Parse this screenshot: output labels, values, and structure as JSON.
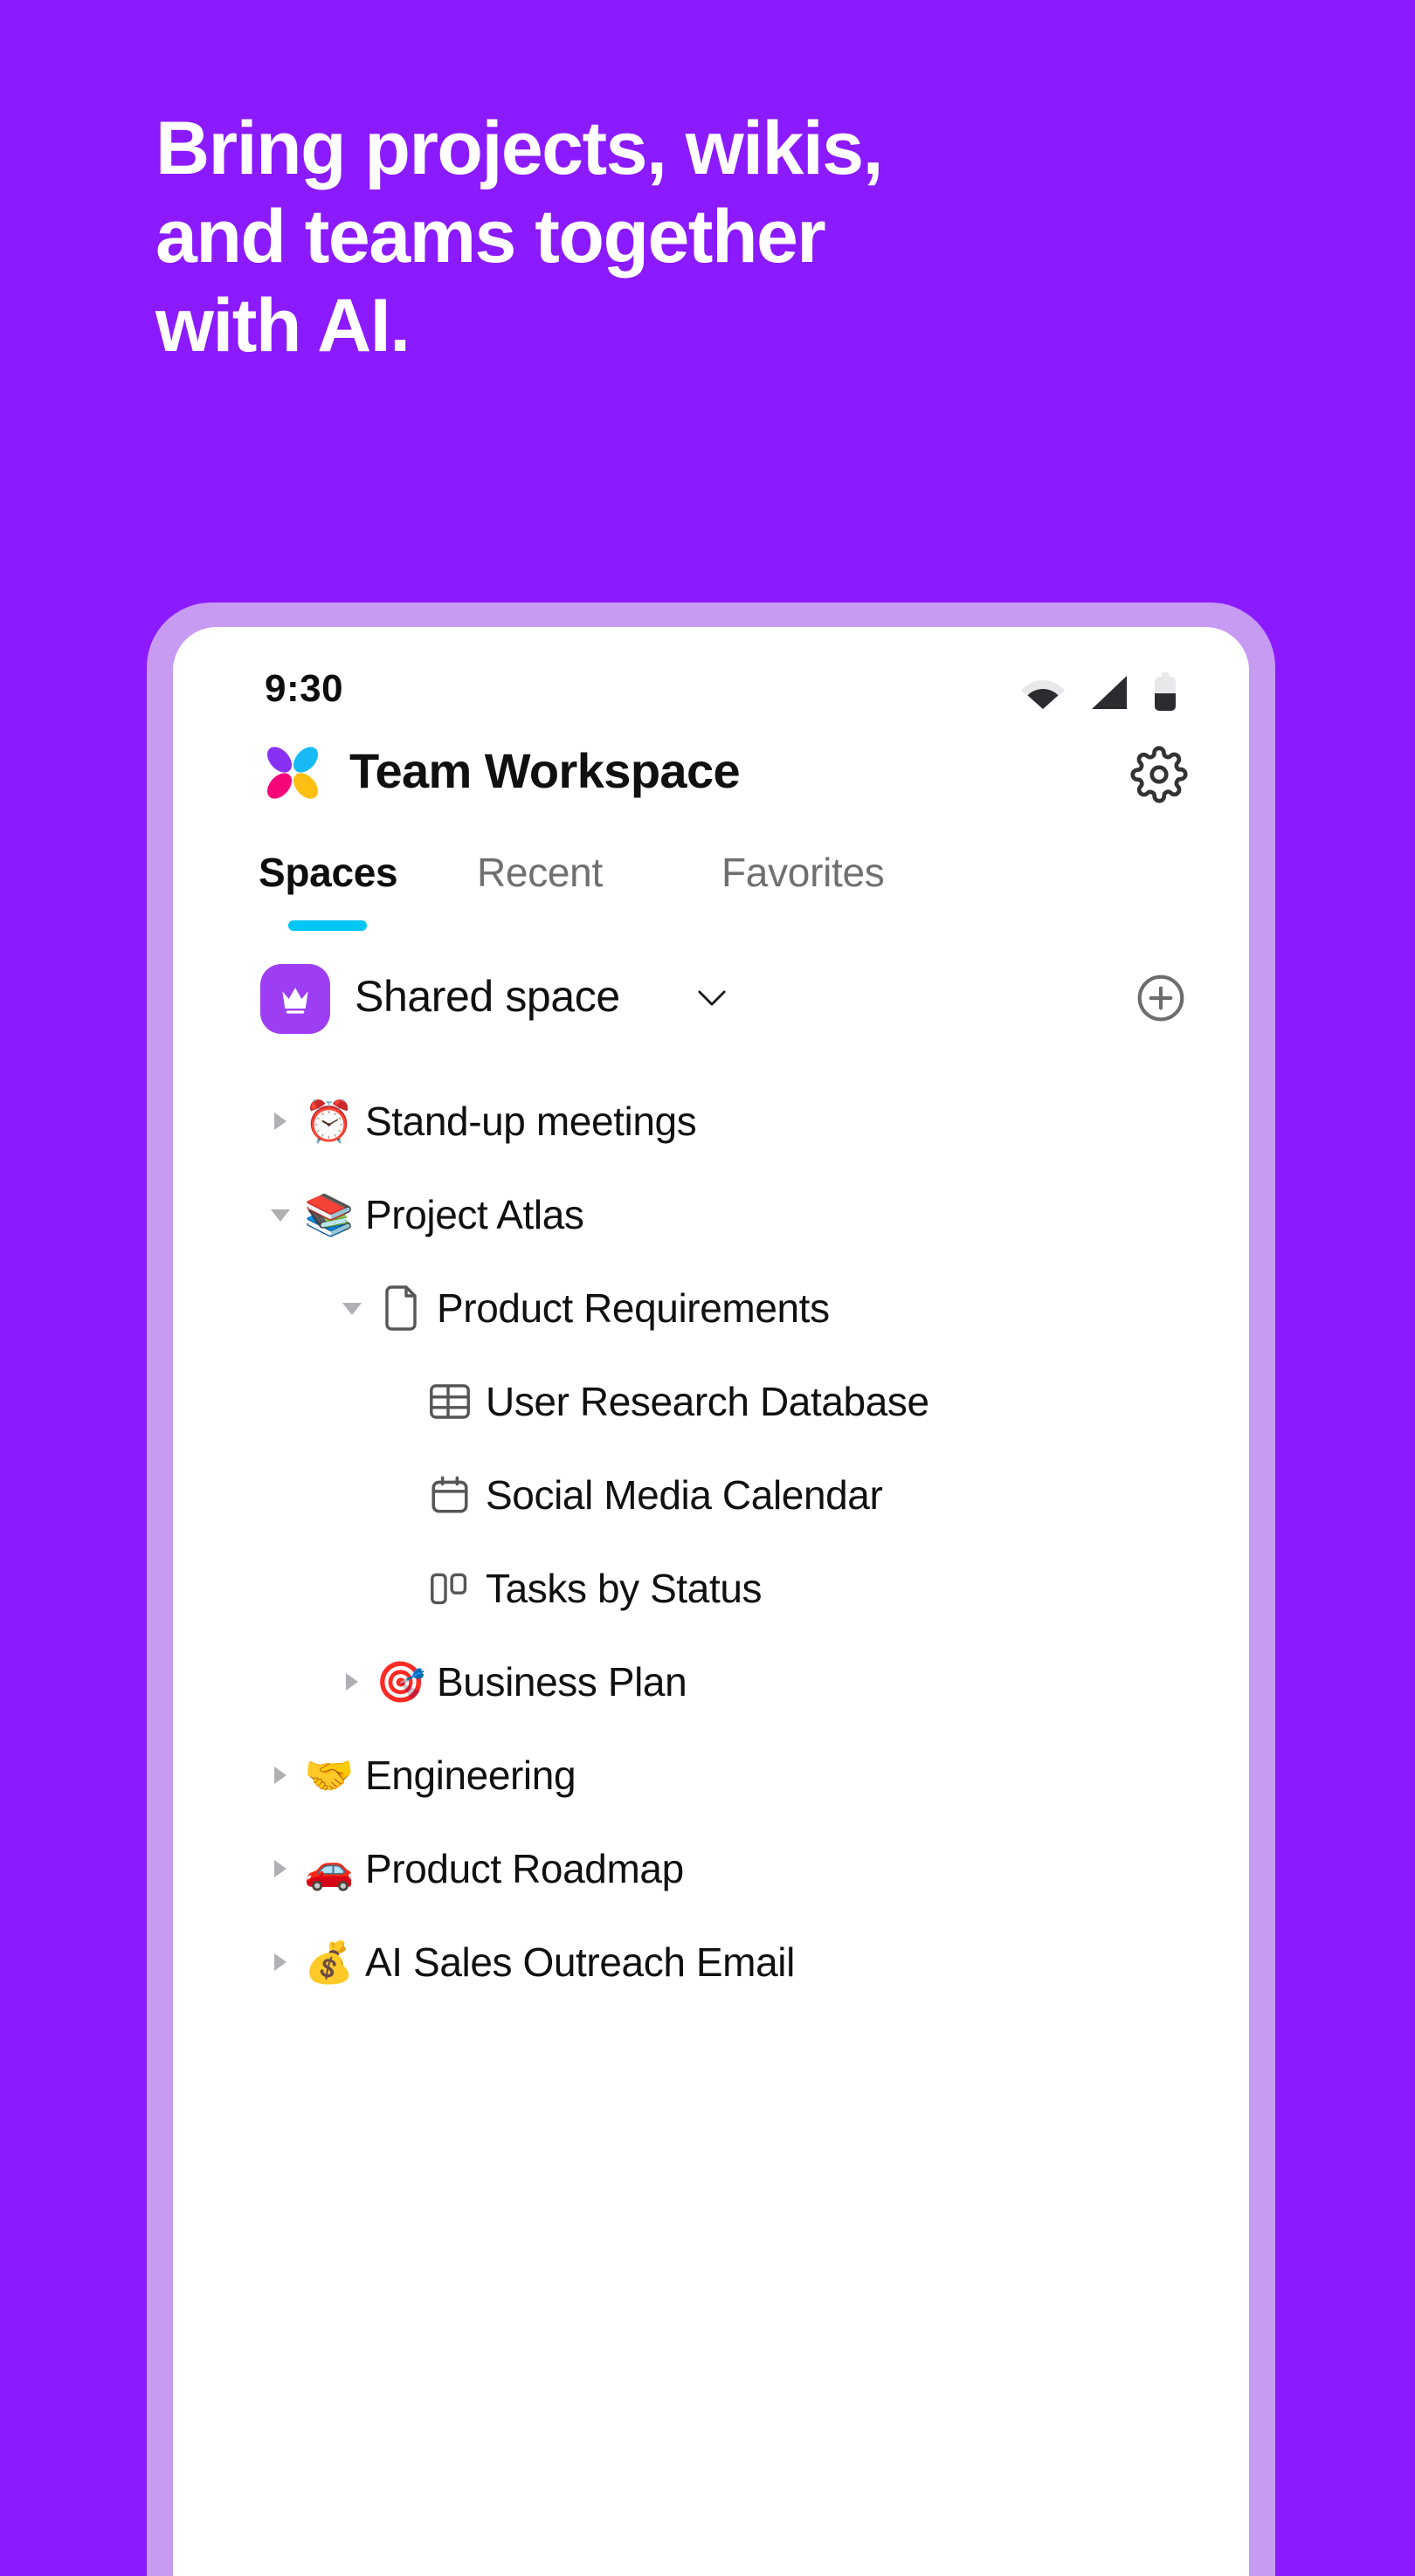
{
  "background_color": "#8c1aff",
  "accent_color": "#00c6f5",
  "headline": {
    "lines": [
      "Bring projects, wikis,",
      "and teams together",
      "with AI."
    ]
  },
  "phone": {
    "frame_color": "#c79bf2",
    "screen_color": "#ffffff",
    "status_bar": {
      "time": "9:30",
      "icons": [
        "wifi-icon",
        "cellular-signal-icon",
        "battery-icon"
      ]
    },
    "app_header": {
      "logo_icon": "clickup-petals-logo",
      "title": "Team Workspace",
      "settings_icon": "gear-icon"
    },
    "tabs": {
      "items": [
        {
          "label": "Spaces",
          "active": true
        },
        {
          "label": "Recent",
          "active": false
        },
        {
          "label": "Favorites",
          "active": false
        }
      ]
    },
    "space_row": {
      "avatar_icon": "crown-icon",
      "avatar_color": "#9d3ef5",
      "name": "Shared space",
      "chevron_icon": "chevron-down-icon",
      "add_icon": "plus-circle-icon"
    },
    "tree": {
      "rows": [
        {
          "label": "Stand-up meetings",
          "emoji": "⏰",
          "icon": "alarm-clock-emoji",
          "depth": 0,
          "twisty": "collapsed"
        },
        {
          "label": "Project Atlas",
          "emoji": "📚",
          "icon": "books-emoji",
          "depth": 0,
          "twisty": "expanded"
        },
        {
          "label": "Product Requirements",
          "emoji": "",
          "icon": "doc-icon",
          "depth": 1,
          "twisty": "expanded"
        },
        {
          "label": "User Research Database",
          "emoji": "",
          "icon": "table-icon",
          "depth": 2,
          "twisty": "none"
        },
        {
          "label": "Social Media Calendar",
          "emoji": "",
          "icon": "calendar-icon",
          "depth": 2,
          "twisty": "none"
        },
        {
          "label": "Tasks by Status",
          "emoji": "",
          "icon": "board-icon",
          "depth": 2,
          "twisty": "none"
        },
        {
          "label": "Business Plan",
          "emoji": "🎯",
          "icon": "dart-emoji",
          "depth": 1,
          "twisty": "collapsed"
        },
        {
          "label": "Engineering",
          "emoji": "🤝",
          "icon": "handshake-emoji",
          "depth": 0,
          "twisty": "collapsed"
        },
        {
          "label": "Product Roadmap",
          "emoji": "🚗",
          "icon": "car-emoji",
          "depth": 0,
          "twisty": "collapsed"
        },
        {
          "label": "AI Sales Outreach Email",
          "emoji": "💰",
          "icon": "money-bag-emoji",
          "depth": 0,
          "twisty": "collapsed"
        }
      ]
    }
  }
}
